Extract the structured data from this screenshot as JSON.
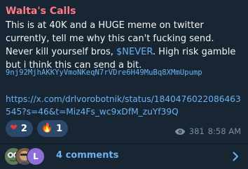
{
  "message": {
    "author": "Walta's Calls",
    "text_before": "This is at 40K and a HUGE meme on twitter currently, tell me why this can't fucking send. Never kill yourself bros, ",
    "ticker": "$NEVER",
    "text_after": ". High risk gamble but i think this can send a bit.",
    "contract": "9nj92MjhAKKYyVmoNKeqN7rVDre6H49MuBq8XMmUpump",
    "link": "https://x.com/drlvorobotnik/status/1840476022086463545?s=46&t=Miz4Fs_wc9xDfM_zuYf39Q"
  },
  "reactions": [
    {
      "emoji": "heart",
      "glyph": "❤",
      "count": "2"
    },
    {
      "emoji": "fire",
      "glyph": "🔥",
      "count": "1"
    }
  ],
  "meta": {
    "views": "381",
    "time": "8:58 AM"
  },
  "comments": {
    "label": "4 comments",
    "avatar_letter": "L"
  },
  "colors": {
    "background": "#182533",
    "accent": "#6ab3f3",
    "author": "#ff7a8a"
  }
}
